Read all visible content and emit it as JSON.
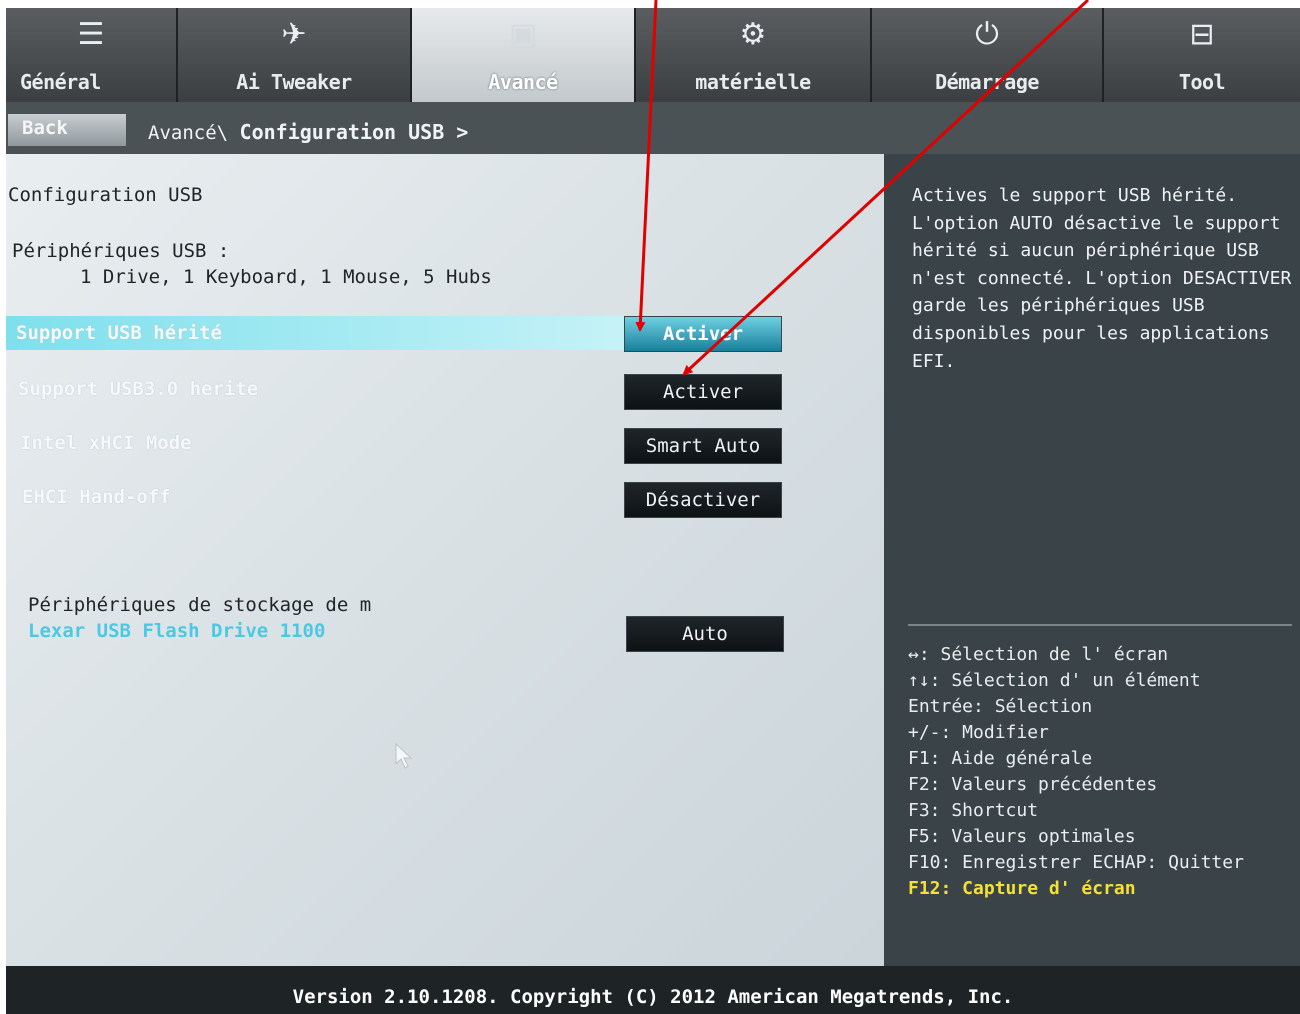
{
  "tabs": [
    {
      "label": "Général",
      "icon": "list-icon"
    },
    {
      "label": "Ai Tweaker",
      "icon": "tweaker-icon"
    },
    {
      "label": "Avancé",
      "icon": "advanced-icon",
      "active": true
    },
    {
      "label": "matérielle",
      "icon": "hardware-icon"
    },
    {
      "label": "Démarrage",
      "icon": "power-icon"
    },
    {
      "label": "Tool",
      "icon": "toolbox-icon"
    }
  ],
  "nav": {
    "back_label": "Back",
    "breadcrumb_prefix": "Avancé\\",
    "breadcrumb_current": "Configuration USB >"
  },
  "main": {
    "section_title": "Configuration USB",
    "devices_label": "Périphériques USB :",
    "devices_value": "1 Drive, 1 Keyboard, 1 Mouse, 5 Hubs",
    "settings": [
      {
        "label": "Support USB hérité",
        "value": "Activer",
        "selected": true
      },
      {
        "label": "Support USB3.0 herite",
        "value": "Activer"
      },
      {
        "label": "Intel xHCI Mode",
        "value": "Smart Auto"
      },
      {
        "label": "EHCI Hand-off",
        "value": "Désactiver"
      }
    ],
    "storage_label": "Périphériques de stockage de m",
    "storage_device": "Lexar USB Flash Drive 1100",
    "storage_value": "Auto"
  },
  "help": {
    "description": "Actives le support USB hérité.\nL'option AUTO désactive le support\nhérité si aucun périphérique USB\nn'est connecté. L'option DESACTIVER\ngarde les périphériques USB\ndisponibles pour les applications\nEFI.",
    "keys": [
      "↔: Sélection de l' écran",
      "↑↓: Sélection d' un élément",
      "Entrée: Sélection",
      "+/-: Modifier",
      "F1: Aide générale",
      "F2: Valeurs précédentes",
      "F3: Shortcut",
      "F5: Valeurs optimales",
      "F10: Enregistrer  ECHAP: Quitter",
      "F12: Capture d' écran"
    ]
  },
  "footer": {
    "version": "Version 2.10.1208. Copyright (C) 2012 American Megatrends, Inc."
  },
  "colors": {
    "accent": "#4cc8e4",
    "highlight": "#7ee0ec",
    "annotation_arrow": "#e00000",
    "hotkey": "#f4e133"
  }
}
